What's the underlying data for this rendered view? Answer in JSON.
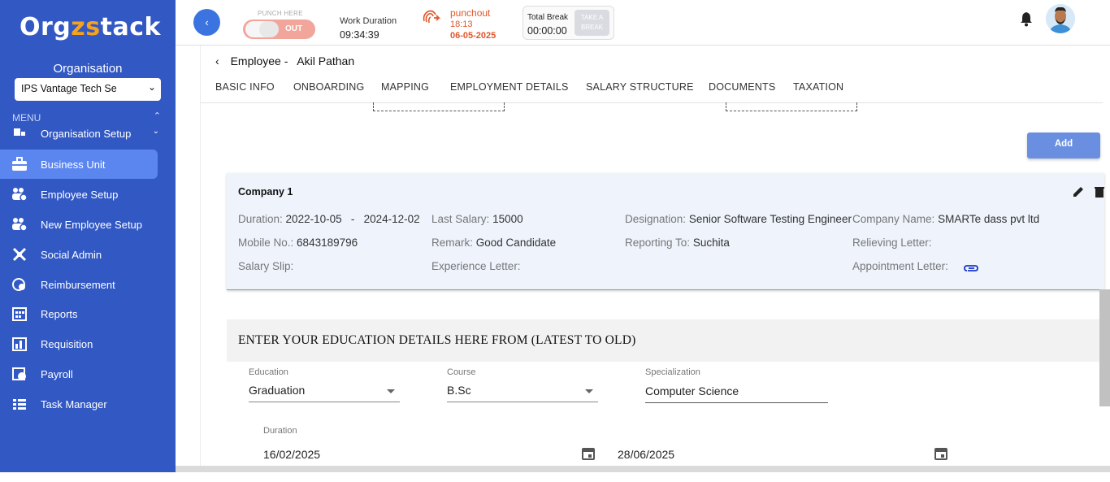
{
  "sidebar": {
    "logo": {
      "pre": "Org",
      "accent": "zs",
      "post": "tack"
    },
    "org_label": "Organisation",
    "org_select": "IPS Vantage Tech Se",
    "menu_label": "MENU",
    "items": [
      {
        "label": "Organisation Setup",
        "icon": "org-setup-icon"
      },
      {
        "label": "Business Unit",
        "icon": "briefcase-icon",
        "active": true
      },
      {
        "label": "Employee Setup",
        "icon": "people-gear-icon"
      },
      {
        "label": "New Employee Setup",
        "icon": "people-gear-icon"
      },
      {
        "label": "Social Admin",
        "icon": "social-icon"
      },
      {
        "label": "Reimbursement",
        "icon": "reimbursement-icon"
      },
      {
        "label": "Reports",
        "icon": "calendar-grid-icon"
      },
      {
        "label": "Requisition",
        "icon": "requisition-icon"
      },
      {
        "label": "Payroll",
        "icon": "payroll-icon"
      },
      {
        "label": "Task Manager",
        "icon": "task-icon"
      }
    ]
  },
  "topbar": {
    "punch_here": "PUNCH HERE",
    "toggle_label": "OUT",
    "work_duration_label": "Work Duration",
    "work_duration_value": "09:34:39",
    "punchout_label": "punchout",
    "punchout_time": "18:13",
    "punchout_date": "06-05-2025",
    "total_break_label": "Total Break",
    "total_break_value": "00:00:00",
    "take_break_line1": "TAKE A",
    "take_break_line2": "BREAK"
  },
  "breadcrumb": {
    "prefix": "Employee -",
    "name": "Akil Pathan"
  },
  "tabs": [
    "BASIC INFO",
    "ONBOARDING",
    "MAPPING",
    "EMPLOYMENT DETAILS",
    "SALARY STRUCTURE",
    "DOCUMENTS",
    "TAXATION"
  ],
  "add_button": "Add",
  "company": {
    "title": "Company 1",
    "duration_label": "Duration:",
    "duration_value": "2022-10-05   -   2024-12-02",
    "last_salary_label": "Last Salary:",
    "last_salary_value": "15000",
    "designation_label": "Designation:",
    "designation_value": "Senior Software Testing Engineer",
    "company_name_label": "Company Name:",
    "company_name_value": "SMARTe dass pvt ltd",
    "mobile_label": "Mobile No.:",
    "mobile_value": "6843189796",
    "remark_label": "Remark:",
    "remark_value": "Good Candidate",
    "reporting_label": "Reporting To:",
    "reporting_value": "Suchita",
    "relieving_label": "Relieving Letter:",
    "salary_slip_label": "Salary Slip:",
    "experience_label": "Experience Letter:",
    "appointment_label": "Appointment Letter:"
  },
  "education": {
    "heading": "ENTER YOUR EDUCATION DETAILS HERE FROM (LATEST TO OLD)",
    "education_label": "Education",
    "education_value": "Graduation",
    "course_label": "Course",
    "course_value": "B.Sc",
    "specialization_label": "Specialization",
    "specialization_value": "Computer Science",
    "duration_label": "Duration",
    "start_date": "16/02/2025",
    "end_date": "28/06/2025"
  },
  "colors": {
    "sidebar": "#3258c4",
    "active": "#5b86f0",
    "punchout": "#e0562b",
    "accent": "#f6a21a"
  }
}
